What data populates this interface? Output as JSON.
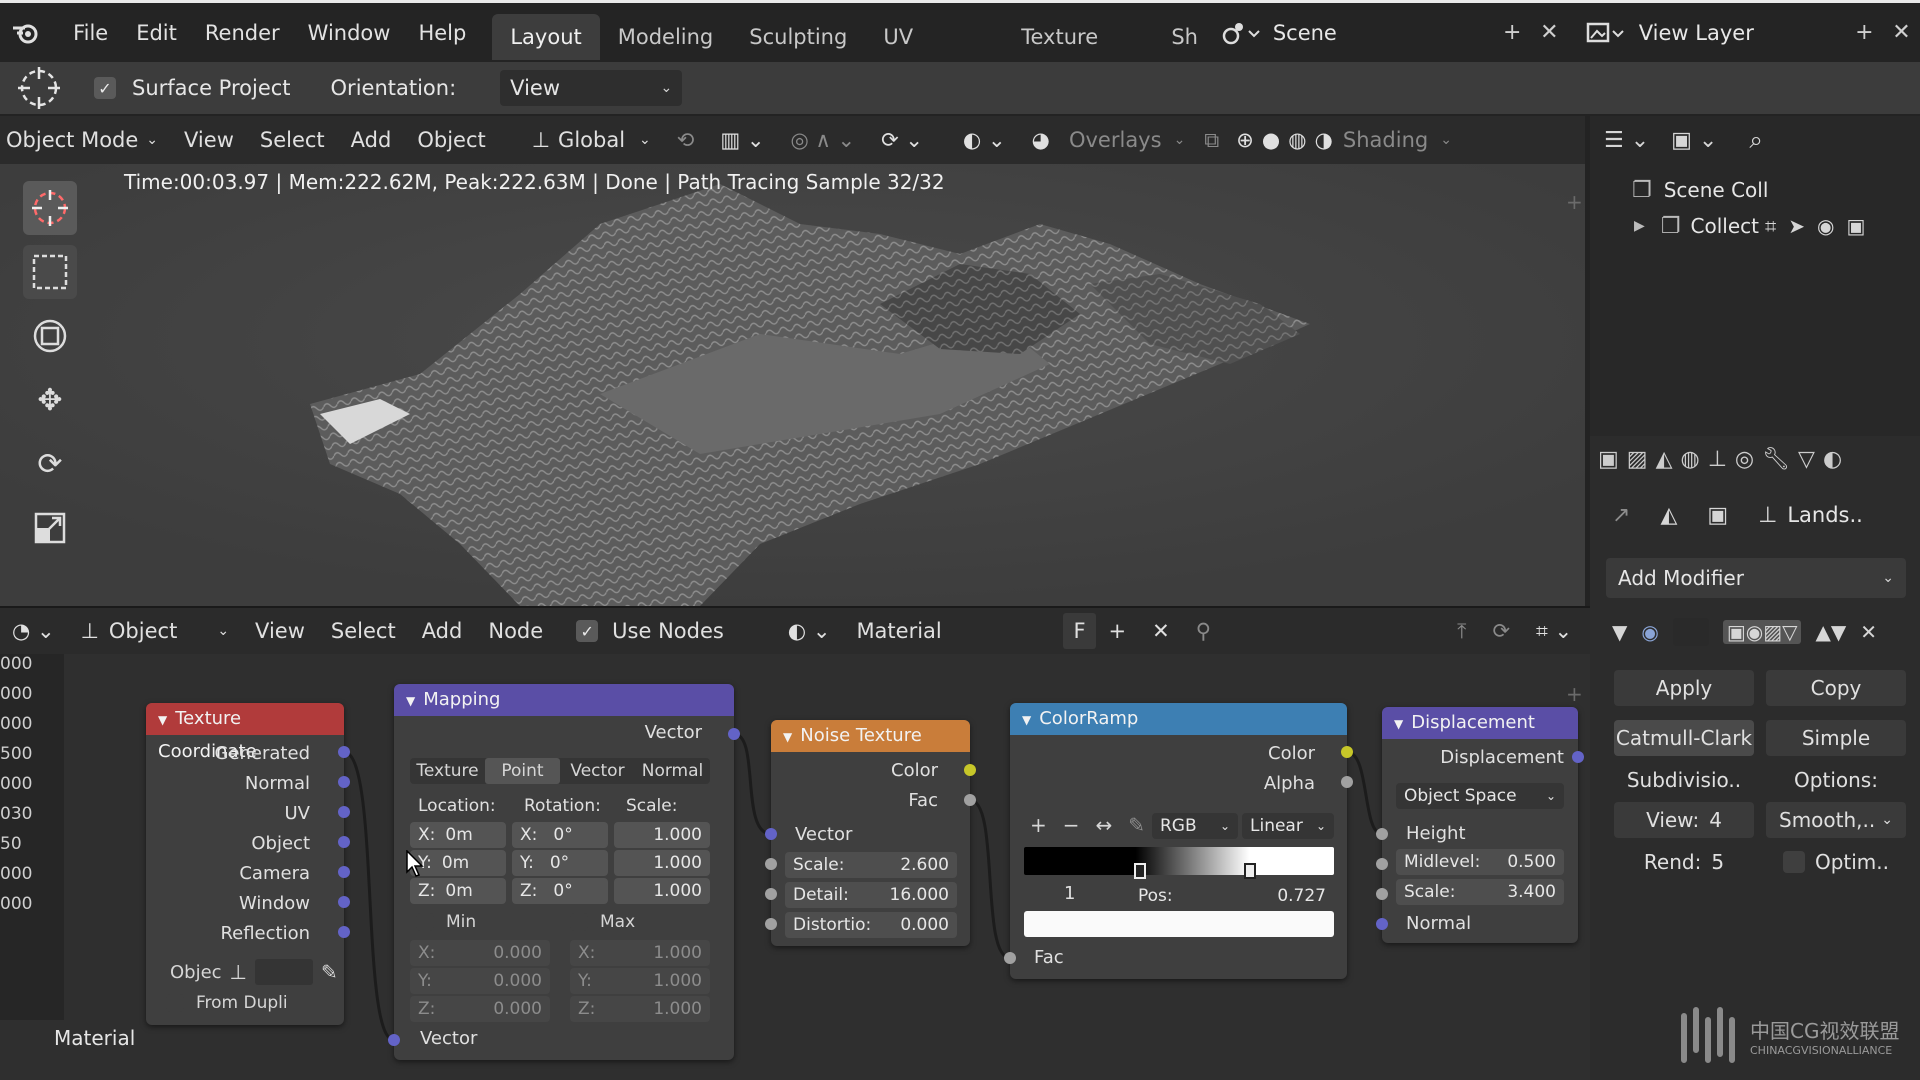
{
  "topbar": {
    "menus": [
      "File",
      "Edit",
      "Render",
      "Window",
      "Help"
    ],
    "workspace_tabs": [
      "Layout",
      "Modeling",
      "Sculpting",
      "UV Editing",
      "Texture Paint",
      "Sh"
    ],
    "active_tab": "Layout",
    "scene_label": "Scene",
    "view_layer_label": "View Layer"
  },
  "tool_settings": {
    "surface_project_label": "Surface Project",
    "orientation_label": "Orientation:",
    "orientation_value": "View"
  },
  "viewport_header": {
    "mode": "Object Mode",
    "menus": [
      "View",
      "Select",
      "Add",
      "Object"
    ],
    "transform_orientation": "Global",
    "overlays_label": "Overlays",
    "shading_label": "Shading"
  },
  "viewport": {
    "stats": "Time:00:03.97 | Mem:222.62M, Peak:222.63M | Done | Path Tracing Sample 32/32"
  },
  "outliner": {
    "scene_collection": "Scene Coll",
    "collection": "Collect"
  },
  "properties": {
    "object_name": "Lands..",
    "add_modifier": "Add Modifier",
    "apply": "Apply",
    "copy": "Copy",
    "catmull_clark": "Catmull-Clark",
    "simple": "Simple",
    "subdivision": "Subdivisio..",
    "options": "Options:",
    "view_label": "View:",
    "view_value": "4",
    "smooth": "Smooth,..",
    "rend_label": "Rend:",
    "rend_value": "5",
    "optim": "Optim.."
  },
  "node_editor_header": {
    "editor_type": "Object",
    "menus": [
      "View",
      "Select",
      "Add",
      "Node"
    ],
    "use_nodes_label": "Use Nodes",
    "material_name": "Material",
    "fake_user": "F"
  },
  "node_editor": {
    "ruler_labels": [
      "000",
      "000",
      "000",
      "500",
      "000",
      "030",
      "50",
      "000",
      "000"
    ],
    "material_footer": "Material",
    "texture_coordinate": {
      "title": "Texture Coordinate",
      "outputs": [
        "Generated",
        "Normal",
        "UV",
        "Object",
        "Camera",
        "Window",
        "Reflection"
      ],
      "object_label": "Objec",
      "from_dupli": "From Dupli"
    },
    "mapping": {
      "title": "Mapping",
      "output": "Vector",
      "tabs": [
        "Texture",
        "Point",
        "Vector",
        "Normal"
      ],
      "active_tab": "Point",
      "location_label": "Location:",
      "rotation_label": "Rotation:",
      "scale_label": "Scale:",
      "loc": [
        {
          "axis": "X:",
          "val": "0m"
        },
        {
          "axis": "Y:",
          "val": "0m"
        },
        {
          "axis": "Z:",
          "val": "0m"
        }
      ],
      "rot": [
        {
          "axis": "X:",
          "val": "0°"
        },
        {
          "axis": "Y:",
          "val": "0°"
        },
        {
          "axis": "Z:",
          "val": "0°"
        }
      ],
      "scale": [
        "1.000",
        "1.000",
        "1.000"
      ],
      "min_label": "Min",
      "max_label": "Max",
      "min": [
        {
          "axis": "X:",
          "val": "0.000"
        },
        {
          "axis": "Y:",
          "val": "0.000"
        },
        {
          "axis": "Z:",
          "val": "0.000"
        }
      ],
      "max": [
        {
          "axis": "X:",
          "val": "1.000"
        },
        {
          "axis": "Y:",
          "val": "1.000"
        },
        {
          "axis": "Z:",
          "val": "1.000"
        }
      ],
      "input": "Vector"
    },
    "noise_texture": {
      "title": "Noise Texture",
      "outputs": [
        "Color",
        "Fac"
      ],
      "input": "Vector",
      "scale_label": "Scale:",
      "scale_value": "2.600",
      "detail_label": "Detail:",
      "detail_value": "16.000",
      "distortion_label": "Distortio:",
      "distortion_value": "0.000"
    },
    "colorramp": {
      "title": "ColorRamp",
      "outputs": [
        "Color",
        "Alpha"
      ],
      "color_mode": "RGB",
      "interpolation": "Linear",
      "stop_index": "1",
      "pos_label": "Pos:",
      "pos_value": "0.727",
      "input": "Fac"
    },
    "displacement": {
      "title": "Displacement",
      "output": "Displacement",
      "space": "Object Space",
      "height_label": "Height",
      "midlevel_label": "Midlevel:",
      "midlevel_value": "0.500",
      "scale_label": "Scale:",
      "scale_value": "3.400",
      "normal_label": "Normal"
    }
  },
  "watermark": {
    "line1": "中国CG视效联盟",
    "line2": "CHINACGVISIONALLIANCE"
  },
  "colors": {
    "accent_blue": "#4772b3",
    "node_texcoord": "#b13b3b",
    "node_mapping": "#5a4ea6",
    "node_noise": "#c97d3a",
    "node_colorramp": "#3d7fb3",
    "node_displacement": "#5a4ea6"
  }
}
